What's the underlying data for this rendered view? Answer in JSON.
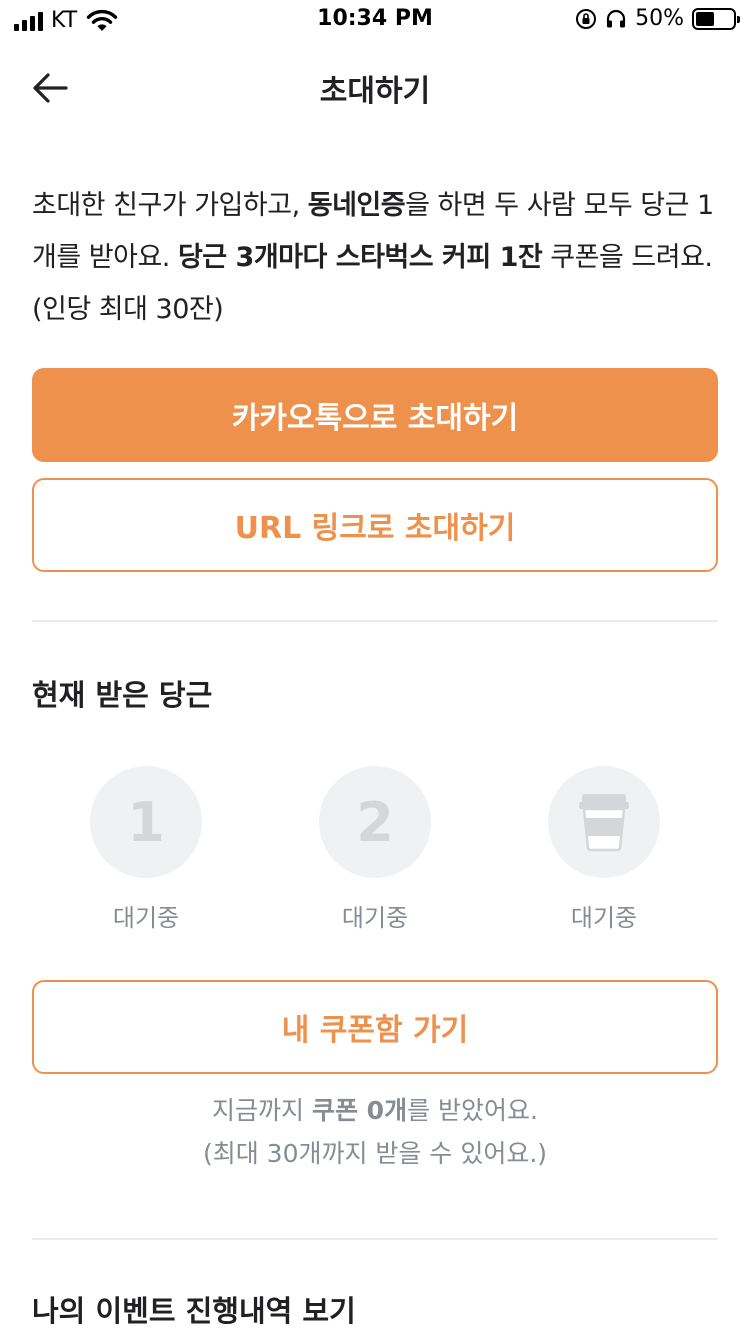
{
  "status_bar": {
    "carrier": "KT",
    "time": "10:34 PM",
    "battery_percent": "50%",
    "battery_level": 0.5
  },
  "nav": {
    "title": "초대하기",
    "back_icon": "arrow-left-icon"
  },
  "intro": {
    "part1": "초대한 친구가 가입하고, ",
    "bold1": "동네인증",
    "part2": "을 하면 두 사람 모두 당근 1개를 받아요. ",
    "bold2": "당근 3개마다 스타벅스 커피 1잔",
    "part3": " 쿠폰을 드려요. (인당 최대 30잔)"
  },
  "buttons": {
    "kakao_invite": "카카오톡으로 초대하기",
    "url_invite": "URL 링크로 초대하기",
    "my_coupons": "내 쿠폰함 가기"
  },
  "carrots_section": {
    "title": "현재 받은 당근",
    "steps": [
      {
        "value": "1",
        "label": "대기중"
      },
      {
        "value": "2",
        "label": "대기중"
      },
      {
        "icon": "coffee-cup-icon",
        "label": "대기중"
      }
    ]
  },
  "coupon_note": {
    "line1_pre": "지금까지 ",
    "line1_bold": "쿠폰 0개",
    "line1_post": "를 받았어요.",
    "line2": "(최대 30개까지 받을 수 있어요.)"
  },
  "events_section": {
    "title": "나의 이벤트 진행내역 보기"
  },
  "colors": {
    "accent": "#ee914d",
    "text": "#212124",
    "muted": "#868b94",
    "circle_bg": "#f0f1f3",
    "divider": "#eaebee"
  }
}
